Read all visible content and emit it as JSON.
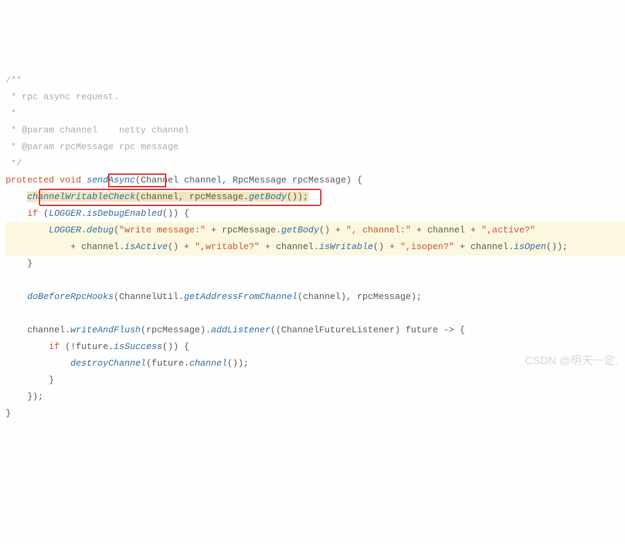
{
  "code": {
    "l1": "/**",
    "l2": " * rpc async request.",
    "l3": " *",
    "l4_a": " * ",
    "l4_b": "@param",
    "l4_c": " channel    netty channel",
    "l5_a": " * ",
    "l5_b": "@param",
    "l5_c": " rpcMessage rpc message",
    "l6": " */",
    "l7_a": "protected",
    "l7_b": " ",
    "l7_c": "void",
    "l7_d": " ",
    "l7_e": "sendAsync",
    "l7_f": "(Channel channel, RpcMessage rpcMessage) {",
    "l8_a": "    ",
    "l8_b": "channelWritableCheck",
    "l8_c": "(channel, rpcMessage.",
    "l8_d": "getBody",
    "l8_e": "());",
    "l9_a": "    ",
    "l9_b": "if",
    "l9_c": " (",
    "l9_d": "LOGGER",
    "l9_e": ".",
    "l9_f": "isDebugEnabled",
    "l9_g": "()) {",
    "l10_a": "        ",
    "l10_b": "LOGGER",
    "l10_c": ".",
    "l10_d": "debug",
    "l10_e": "(",
    "l10_f": "\"write message:\"",
    "l10_g": " + rpcMessage.",
    "l10_h": "getBody",
    "l10_i": "() + ",
    "l10_j": "\", channel:\"",
    "l10_k": " + channel + ",
    "l10_l": "\",active?\"",
    "l11_a": "            + channel.",
    "l11_b": "isActive",
    "l11_c": "() + ",
    "l11_d": "\",writable?\"",
    "l11_e": " + channel.",
    "l11_f": "isWritable",
    "l11_g": "() + ",
    "l11_h": "\",isopen?\"",
    "l11_i": " + channel.",
    "l11_j": "isOpen",
    "l11_k": "());",
    "l12": "    }",
    "l13": "",
    "l14_a": "    ",
    "l14_b": "doBeforeRpcHooks",
    "l14_c": "(ChannelUtil.",
    "l14_d": "getAddressFromChannel",
    "l14_e": "(channel), rpcMessage);",
    "l15": "",
    "l16_a": "    channel.",
    "l16_b": "writeAndFlush",
    "l16_c": "(rpcMessage).",
    "l16_d": "addListener",
    "l16_e": "((ChannelFutureListener) future -> {",
    "l17_a": "        ",
    "l17_b": "if",
    "l17_c": " (!future.",
    "l17_d": "isSuccess",
    "l17_e": "()) {",
    "l18_a": "            ",
    "l18_b": "destroyChannel",
    "l18_c": "(future.",
    "l18_d": "channel",
    "l18_e": "());",
    "l19": "        }",
    "l20": "    });",
    "l21": "}"
  },
  "watermark": "CSDN @明天一定."
}
